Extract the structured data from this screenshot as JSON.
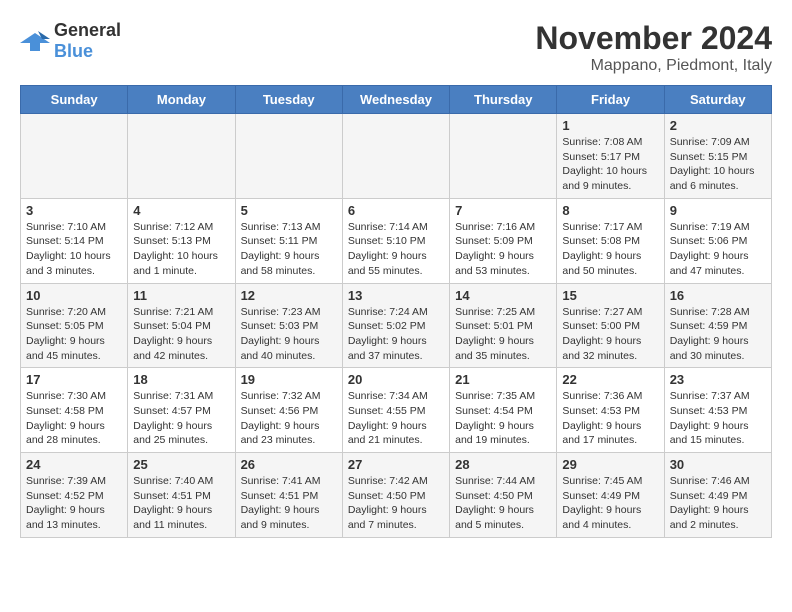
{
  "header": {
    "logo_general": "General",
    "logo_blue": "Blue",
    "month": "November 2024",
    "location": "Mappano, Piedmont, Italy"
  },
  "weekdays": [
    "Sunday",
    "Monday",
    "Tuesday",
    "Wednesday",
    "Thursday",
    "Friday",
    "Saturday"
  ],
  "weeks": [
    [
      {
        "day": "",
        "info": ""
      },
      {
        "day": "",
        "info": ""
      },
      {
        "day": "",
        "info": ""
      },
      {
        "day": "",
        "info": ""
      },
      {
        "day": "",
        "info": ""
      },
      {
        "day": "1",
        "info": "Sunrise: 7:08 AM\nSunset: 5:17 PM\nDaylight: 10 hours and 9 minutes."
      },
      {
        "day": "2",
        "info": "Sunrise: 7:09 AM\nSunset: 5:15 PM\nDaylight: 10 hours and 6 minutes."
      }
    ],
    [
      {
        "day": "3",
        "info": "Sunrise: 7:10 AM\nSunset: 5:14 PM\nDaylight: 10 hours and 3 minutes."
      },
      {
        "day": "4",
        "info": "Sunrise: 7:12 AM\nSunset: 5:13 PM\nDaylight: 10 hours and 1 minute."
      },
      {
        "day": "5",
        "info": "Sunrise: 7:13 AM\nSunset: 5:11 PM\nDaylight: 9 hours and 58 minutes."
      },
      {
        "day": "6",
        "info": "Sunrise: 7:14 AM\nSunset: 5:10 PM\nDaylight: 9 hours and 55 minutes."
      },
      {
        "day": "7",
        "info": "Sunrise: 7:16 AM\nSunset: 5:09 PM\nDaylight: 9 hours and 53 minutes."
      },
      {
        "day": "8",
        "info": "Sunrise: 7:17 AM\nSunset: 5:08 PM\nDaylight: 9 hours and 50 minutes."
      },
      {
        "day": "9",
        "info": "Sunrise: 7:19 AM\nSunset: 5:06 PM\nDaylight: 9 hours and 47 minutes."
      }
    ],
    [
      {
        "day": "10",
        "info": "Sunrise: 7:20 AM\nSunset: 5:05 PM\nDaylight: 9 hours and 45 minutes."
      },
      {
        "day": "11",
        "info": "Sunrise: 7:21 AM\nSunset: 5:04 PM\nDaylight: 9 hours and 42 minutes."
      },
      {
        "day": "12",
        "info": "Sunrise: 7:23 AM\nSunset: 5:03 PM\nDaylight: 9 hours and 40 minutes."
      },
      {
        "day": "13",
        "info": "Sunrise: 7:24 AM\nSunset: 5:02 PM\nDaylight: 9 hours and 37 minutes."
      },
      {
        "day": "14",
        "info": "Sunrise: 7:25 AM\nSunset: 5:01 PM\nDaylight: 9 hours and 35 minutes."
      },
      {
        "day": "15",
        "info": "Sunrise: 7:27 AM\nSunset: 5:00 PM\nDaylight: 9 hours and 32 minutes."
      },
      {
        "day": "16",
        "info": "Sunrise: 7:28 AM\nSunset: 4:59 PM\nDaylight: 9 hours and 30 minutes."
      }
    ],
    [
      {
        "day": "17",
        "info": "Sunrise: 7:30 AM\nSunset: 4:58 PM\nDaylight: 9 hours and 28 minutes."
      },
      {
        "day": "18",
        "info": "Sunrise: 7:31 AM\nSunset: 4:57 PM\nDaylight: 9 hours and 25 minutes."
      },
      {
        "day": "19",
        "info": "Sunrise: 7:32 AM\nSunset: 4:56 PM\nDaylight: 9 hours and 23 minutes."
      },
      {
        "day": "20",
        "info": "Sunrise: 7:34 AM\nSunset: 4:55 PM\nDaylight: 9 hours and 21 minutes."
      },
      {
        "day": "21",
        "info": "Sunrise: 7:35 AM\nSunset: 4:54 PM\nDaylight: 9 hours and 19 minutes."
      },
      {
        "day": "22",
        "info": "Sunrise: 7:36 AM\nSunset: 4:53 PM\nDaylight: 9 hours and 17 minutes."
      },
      {
        "day": "23",
        "info": "Sunrise: 7:37 AM\nSunset: 4:53 PM\nDaylight: 9 hours and 15 minutes."
      }
    ],
    [
      {
        "day": "24",
        "info": "Sunrise: 7:39 AM\nSunset: 4:52 PM\nDaylight: 9 hours and 13 minutes."
      },
      {
        "day": "25",
        "info": "Sunrise: 7:40 AM\nSunset: 4:51 PM\nDaylight: 9 hours and 11 minutes."
      },
      {
        "day": "26",
        "info": "Sunrise: 7:41 AM\nSunset: 4:51 PM\nDaylight: 9 hours and 9 minutes."
      },
      {
        "day": "27",
        "info": "Sunrise: 7:42 AM\nSunset: 4:50 PM\nDaylight: 9 hours and 7 minutes."
      },
      {
        "day": "28",
        "info": "Sunrise: 7:44 AM\nSunset: 4:50 PM\nDaylight: 9 hours and 5 minutes."
      },
      {
        "day": "29",
        "info": "Sunrise: 7:45 AM\nSunset: 4:49 PM\nDaylight: 9 hours and 4 minutes."
      },
      {
        "day": "30",
        "info": "Sunrise: 7:46 AM\nSunset: 4:49 PM\nDaylight: 9 hours and 2 minutes."
      }
    ]
  ]
}
